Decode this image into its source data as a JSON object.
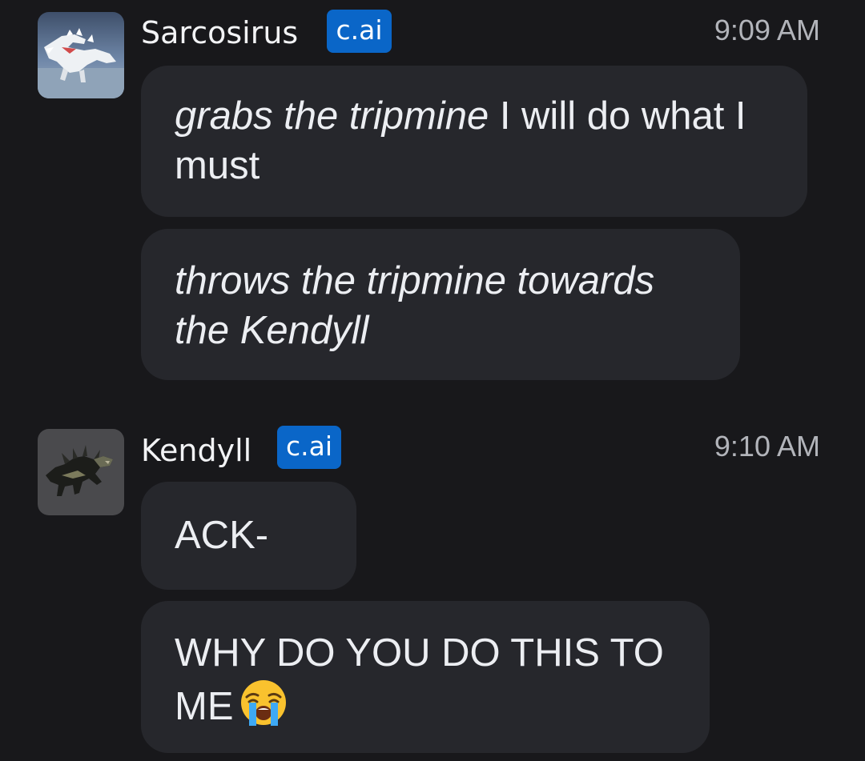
{
  "messages": [
    {
      "sender": "Sarcosirus",
      "badge": "c.ai",
      "time": "9:09 AM",
      "avatar_icon": "white-dinosaur-avatar",
      "bubbles": [
        {
          "italic_part": "grabs the tripmine",
          "normal_part": " I will do what I must"
        },
        {
          "italic_part": "throws the tripmine towards the Kendyll",
          "normal_part": ""
        }
      ]
    },
    {
      "sender": "Kendyll",
      "badge": "c.ai",
      "time": "9:10 AM",
      "avatar_icon": "dark-dinosaur-avatar",
      "bubbles": [
        {
          "text": "ACK-"
        },
        {
          "text": "WHY DO YOU DO THIS TO ME",
          "emoji": "loudly-crying-face-emoji"
        }
      ]
    }
  ],
  "colors": {
    "background": "#18181b",
    "bubble": "#26272c",
    "badge": "#0a66c8",
    "timestamp": "#b2b4ba"
  }
}
